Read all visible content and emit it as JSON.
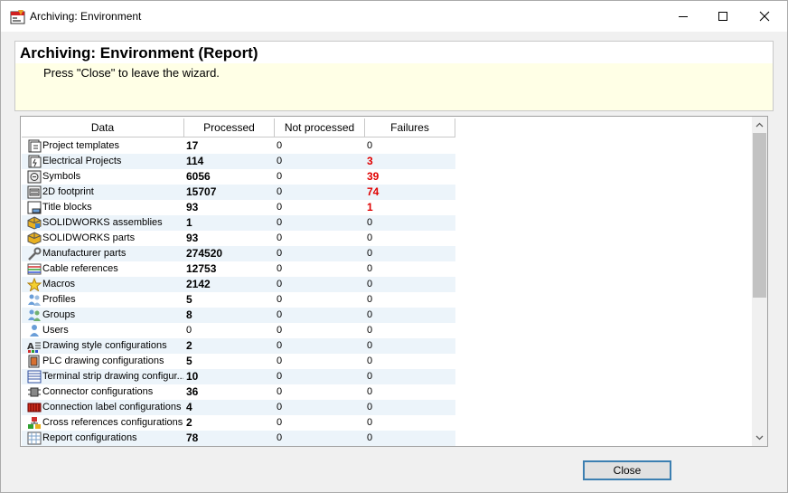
{
  "window": {
    "title": "Archiving: Environment"
  },
  "header": {
    "title": "Archiving: Environment (Report)",
    "subtitle": "Press \"Close\" to leave the wizard."
  },
  "table": {
    "columns": [
      "Data",
      "Processed",
      "Not processed",
      "Failures"
    ],
    "rows": [
      {
        "icon": "project-template-icon",
        "label": "Project templates",
        "processed": "17",
        "not_processed": "0",
        "failures": "0"
      },
      {
        "icon": "electrical-project-icon",
        "label": "Electrical Projects",
        "processed": "114",
        "not_processed": "0",
        "failures": "3"
      },
      {
        "icon": "symbol-icon",
        "label": "Symbols",
        "processed": "6056",
        "not_processed": "0",
        "failures": "39"
      },
      {
        "icon": "footprint-icon",
        "label": "2D footprint",
        "processed": "15707",
        "not_processed": "0",
        "failures": "74"
      },
      {
        "icon": "title-block-icon",
        "label": "Title blocks",
        "processed": "93",
        "not_processed": "0",
        "failures": "1"
      },
      {
        "icon": "assembly-icon",
        "label": "SOLIDWORKS assemblies",
        "processed": "1",
        "not_processed": "0",
        "failures": "0"
      },
      {
        "icon": "part-icon",
        "label": "SOLIDWORKS parts",
        "processed": "93",
        "not_processed": "0",
        "failures": "0"
      },
      {
        "icon": "wrench-icon",
        "label": "Manufacturer parts",
        "processed": "274520",
        "not_processed": "0",
        "failures": "0"
      },
      {
        "icon": "cable-icon",
        "label": "Cable references",
        "processed": "12753",
        "not_processed": "0",
        "failures": "0"
      },
      {
        "icon": "star-icon",
        "label": "Macros",
        "processed": "2142",
        "not_processed": "0",
        "failures": "0"
      },
      {
        "icon": "profiles-icon",
        "label": "Profiles",
        "processed": "5",
        "not_processed": "0",
        "failures": "0"
      },
      {
        "icon": "groups-icon",
        "label": "Groups",
        "processed": "8",
        "not_processed": "0",
        "failures": "0"
      },
      {
        "icon": "user-icon",
        "label": "Users",
        "processed": "0",
        "not_processed": "0",
        "failures": "0"
      },
      {
        "icon": "drawing-style-icon",
        "label": "Drawing style configurations",
        "processed": "2",
        "not_processed": "0",
        "failures": "0"
      },
      {
        "icon": "plc-icon",
        "label": "PLC drawing configurations",
        "processed": "5",
        "not_processed": "0",
        "failures": "0"
      },
      {
        "icon": "terminal-strip-icon",
        "label": "Terminal strip drawing configur...",
        "processed": "10",
        "not_processed": "0",
        "failures": "0"
      },
      {
        "icon": "connector-icon",
        "label": "Connector configurations",
        "processed": "36",
        "not_processed": "0",
        "failures": "0"
      },
      {
        "icon": "connection-label-icon",
        "label": "Connection label configurations",
        "processed": "4",
        "not_processed": "0",
        "failures": "0"
      },
      {
        "icon": "cross-reference-icon",
        "label": "Cross references configurations",
        "processed": "2",
        "not_processed": "0",
        "failures": "0"
      },
      {
        "icon": "report-icon",
        "label": "Report configurations",
        "processed": "78",
        "not_processed": "0",
        "failures": "0"
      }
    ]
  },
  "footer": {
    "close_label": "Close"
  },
  "colors": {
    "failure": "#e00000",
    "header_bg": "#ffffe6",
    "row_alt": "#ecf4fa",
    "button_border": "#3c7fb1"
  }
}
